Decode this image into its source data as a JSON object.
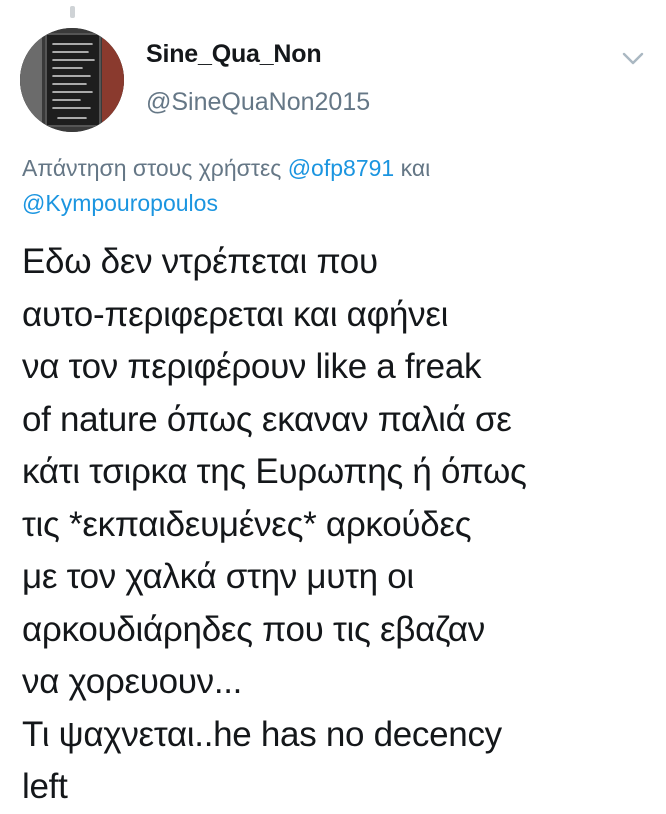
{
  "tweet": {
    "display_name": "Sine_Qua_Non",
    "handle": "@SineQuaNon2015",
    "reply_context": {
      "prefix": "Απάντηση στους χρήστες ",
      "mention_1": "@ofp8791",
      "connector": " και",
      "mention_2": "@Kympouropoulos"
    },
    "text_lines": [
      "Εδω δεν ντρέπεται που",
      "αυτο-περιφερεται και αφήνει",
      "να τον περιφέρουν like a freak",
      "of nature όπως εκαναν παλιά σε",
      "κάτι τσιρκα της Ευρωπης ή όπως",
      "τις *εκπαιδευμένες* αρκούδες",
      "με τον χαλκά στην μυτη οι",
      "αρκουδιάρηδες που τις εβαζαν",
      "να χορευουν...",
      "Τι ψαχνεται..he has no decency",
      "left"
    ]
  },
  "icons": {
    "avatar": "avatar-image",
    "menu": "chevron-down-icon"
  },
  "colors": {
    "text": "#14171a",
    "secondary": "#657786",
    "link": "#1b95e0",
    "background": "#ffffff"
  }
}
